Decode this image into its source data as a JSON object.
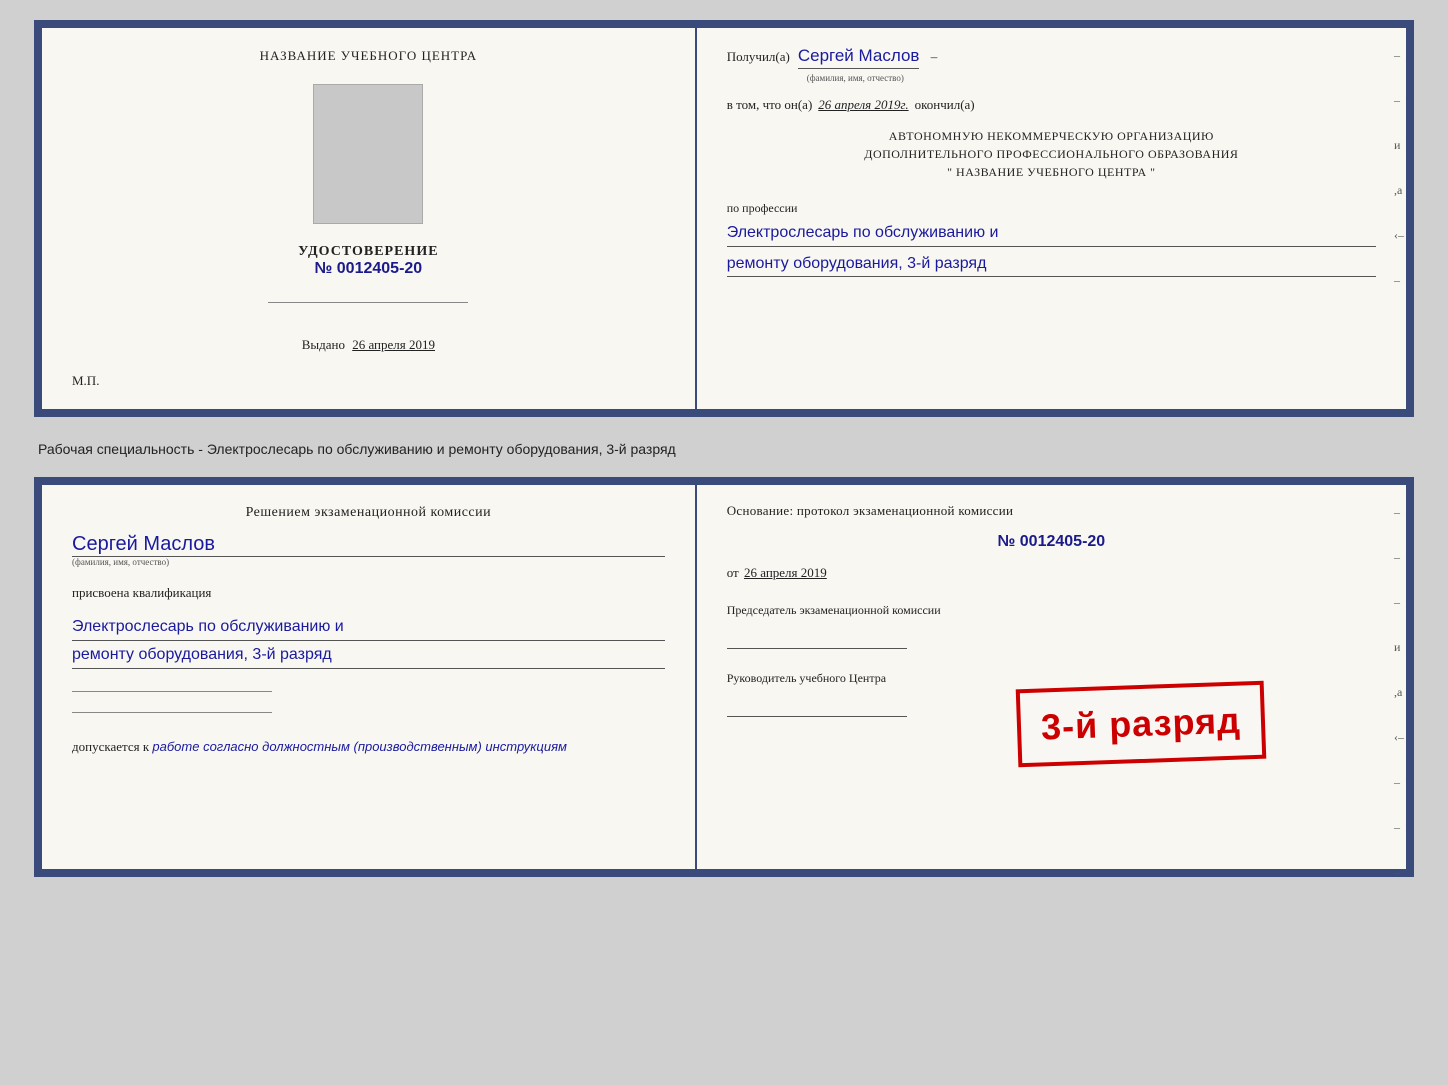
{
  "top_cert": {
    "left": {
      "title": "НАЗВАНИЕ УЧЕБНОГО ЦЕНТРА",
      "udost_label": "УДОСТОВЕРЕНИЕ",
      "udost_num": "№ 0012405-20",
      "vydano_label": "Выдано",
      "vydano_date": "26 апреля 2019",
      "mp": "М.П."
    },
    "right": {
      "poluchil_label": "Получил(а)",
      "poluchil_name": "Сергей Маслов",
      "fio_sub": "(фамилия, имя, отчество)",
      "vtom_label": "в том, что он(а)",
      "vtom_date": "26 апреля 2019г.",
      "okonchil": "окончил(а)",
      "org_line1": "АВТОНОМНУЮ НЕКОММЕРЧЕСКУЮ ОРГАНИЗАЦИЮ",
      "org_line2": "ДОПОЛНИТЕЛЬНОГО ПРОФЕССИОНАЛЬНОГО ОБРАЗОВАНИЯ",
      "org_line3": "\"   НАЗВАНИЕ УЧЕБНОГО ЦЕНТРА   \"",
      "po_professii": "по профессии",
      "profession1": "Электрослесарь по обслуживанию и",
      "profession2": "ремонту оборудования, 3-й разряд"
    }
  },
  "between": {
    "text": "Рабочая специальность - Электрослесарь по обслуживанию и ремонту оборудования, 3-й разряд"
  },
  "bottom_cert": {
    "left": {
      "resheniem": "Решением экзаменационной комиссии",
      "name": "Сергей Маслов",
      "fio_sub": "(фамилия, имя, отчество)",
      "prisvoena": "присвоена квалификация",
      "qual1": "Электрослесарь по обслуживанию и",
      "qual2": "ремонту оборудования, 3-й разряд",
      "dopusk_label": "допускается к",
      "dopusk_text": "работе согласно должностным (производственным) инструкциям"
    },
    "right": {
      "osnov_label": "Основание: протокол экзаменационной комиссии",
      "prot_num": "№  0012405-20",
      "ot_label": "от",
      "ot_date": "26 апреля 2019",
      "predsedatel_label": "Председатель экзаменационной комиссии",
      "rukovoditel_label": "Руководитель учебного Центра"
    },
    "stamp": {
      "text": "3-й разряд"
    }
  }
}
